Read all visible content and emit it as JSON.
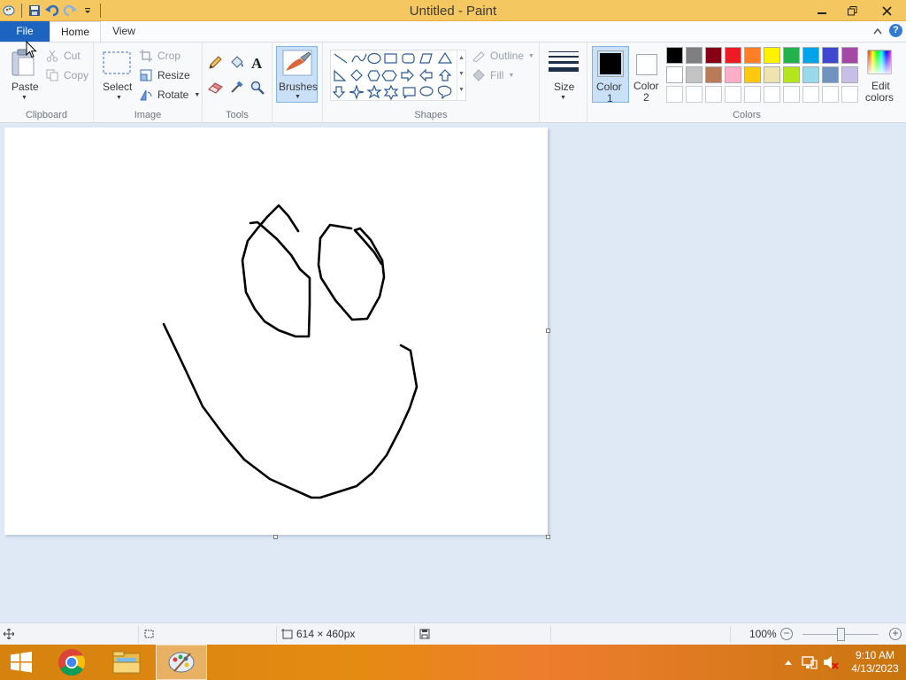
{
  "window": {
    "title": "Untitled - Paint"
  },
  "tabs": {
    "file": "File",
    "home": "Home",
    "view": "View"
  },
  "clipboard": {
    "paste": "Paste",
    "cut": "Cut",
    "copy": "Copy",
    "label": "Clipboard"
  },
  "image": {
    "select": "Select",
    "crop": "Crop",
    "resize": "Resize",
    "rotate": "Rotate",
    "label": "Image"
  },
  "tools": {
    "label": "Tools",
    "brushes": "Brushes"
  },
  "shapes": {
    "outline": "Outline",
    "fill": "Fill",
    "label": "Shapes"
  },
  "size": {
    "label": "Size"
  },
  "colors": {
    "color1_line1": "Color",
    "color1_line2": "1",
    "color2_line1": "Color",
    "color2_line2": "2",
    "edit_line1": "Edit",
    "edit_line2": "colors",
    "label": "Colors",
    "color1": "#000000",
    "color2": "#ffffff",
    "palette_row1": [
      "#000000",
      "#7f7f7f",
      "#880015",
      "#ed1c24",
      "#ff7f27",
      "#fff200",
      "#22b14c",
      "#00a2e8",
      "#3f48cc",
      "#a349a4"
    ],
    "palette_row2": [
      "#ffffff",
      "#c3c3c3",
      "#b97a57",
      "#ffaec9",
      "#ffc90e",
      "#efe4b0",
      "#b5e61d",
      "#99d9ea",
      "#7092be",
      "#c8bfe7"
    ]
  },
  "status": {
    "dimensions": "614 × 460px",
    "zoom": "100%"
  },
  "taskbar": {
    "time": "9:10 AM",
    "date": "4/13/2023"
  }
}
